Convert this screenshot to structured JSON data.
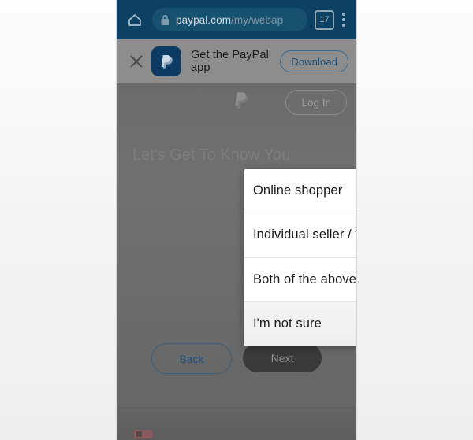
{
  "browser": {
    "home_icon": "home-icon",
    "lock_icon": "lock-icon",
    "url_secure_part": "paypal.com",
    "url_path_part": "/my/webap",
    "tab_count": "17",
    "menu_icon": "kebab-menu-icon",
    "toolbar_color": "#0d4163"
  },
  "app_banner": {
    "close_icon": "close-icon",
    "app_icon": "paypal-app-icon",
    "text": "Get the PayPal app",
    "download_label": "Download",
    "accent_color": "#1c4f77"
  },
  "page": {
    "logo": "paypal-logo",
    "login_label": "Log In",
    "heading": "Let's Get To Know You",
    "back_label": "Back",
    "next_label": "Next",
    "back_color": "#1d4f7c",
    "next_bg": "#3a3a3a"
  },
  "dialog": {
    "options": [
      {
        "label": "Online shopper",
        "selected": false,
        "radio_icon": "radio-unchecked-icon"
      },
      {
        "label": "Individual seller / freelancer",
        "selected": false,
        "radio_icon": "radio-unchecked-icon"
      },
      {
        "label": "Both of the above",
        "selected": false,
        "radio_icon": "radio-unchecked-icon"
      },
      {
        "label": "I'm not sure",
        "selected": false,
        "radio_icon": "radio-unchecked-icon"
      }
    ]
  }
}
